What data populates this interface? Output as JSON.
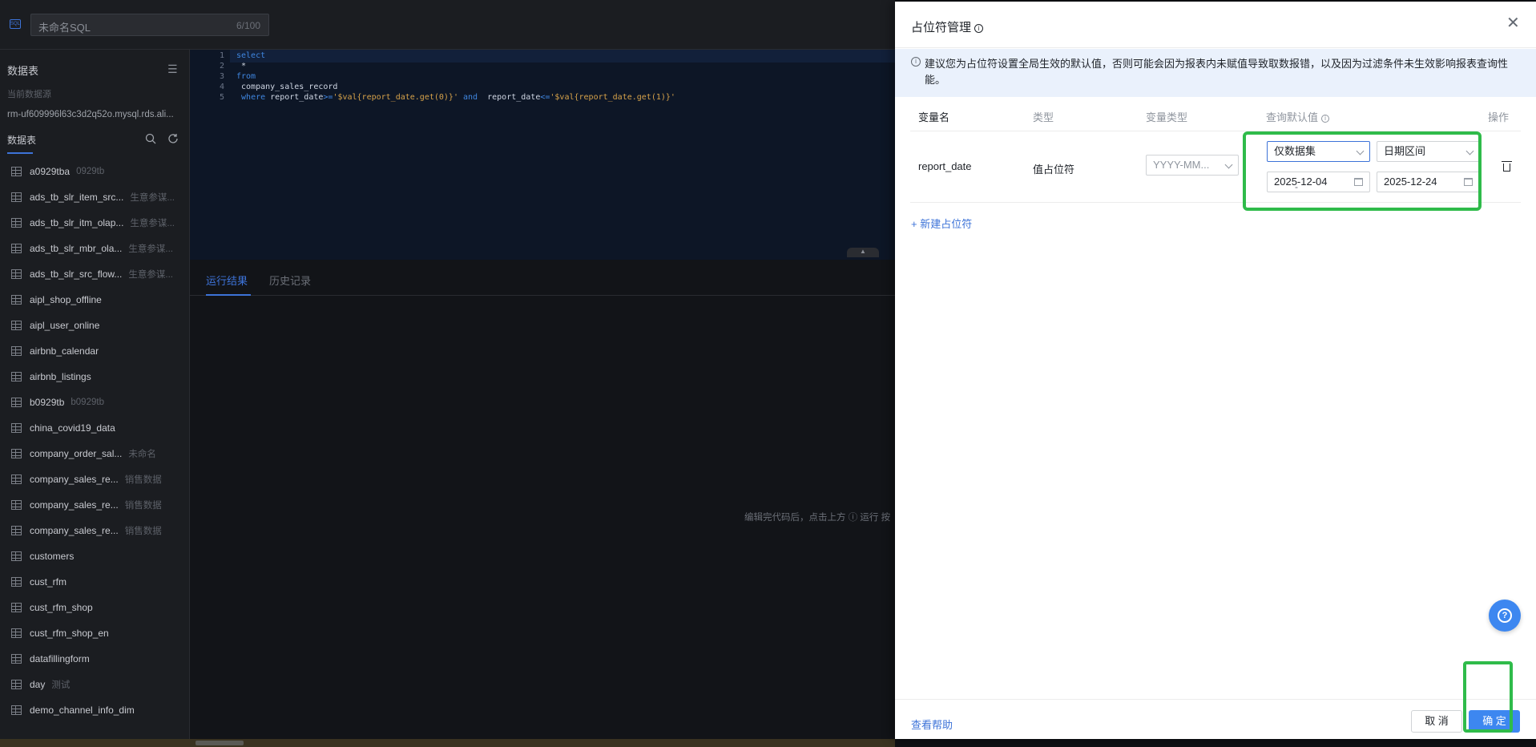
{
  "topbar": {
    "sql_icon": "SQL",
    "query_name": "未命名SQL",
    "name_count": "6/100"
  },
  "sidebar": {
    "title": "数据表",
    "datasource_label": "当前数据源",
    "datasource": "rm-uf609996l63c3d2q52o.mysql.rds.ali...",
    "tab_label": "数据表",
    "tables": [
      {
        "name": "a0929tba",
        "alias": "0929tb"
      },
      {
        "name": "ads_tb_slr_item_src...",
        "alias": "生意参谋..."
      },
      {
        "name": "ads_tb_slr_itm_olap...",
        "alias": "生意参谋..."
      },
      {
        "name": "ads_tb_slr_mbr_ola...",
        "alias": "生意参谋..."
      },
      {
        "name": "ads_tb_slr_src_flow...",
        "alias": "生意参谋..."
      },
      {
        "name": "aipl_shop_offline",
        "alias": ""
      },
      {
        "name": "aipl_user_online",
        "alias": ""
      },
      {
        "name": "airbnb_calendar",
        "alias": ""
      },
      {
        "name": "airbnb_listings",
        "alias": ""
      },
      {
        "name": "b0929tb",
        "alias": "b0929tb"
      },
      {
        "name": "china_covid19_data",
        "alias": ""
      },
      {
        "name": "company_order_sal...",
        "alias": "未命名"
      },
      {
        "name": "company_sales_re...",
        "alias": "销售数据"
      },
      {
        "name": "company_sales_re...",
        "alias": "销售数据"
      },
      {
        "name": "company_sales_re...",
        "alias": "销售数据"
      },
      {
        "name": "customers",
        "alias": ""
      },
      {
        "name": "cust_rfm",
        "alias": ""
      },
      {
        "name": "cust_rfm_shop",
        "alias": ""
      },
      {
        "name": "cust_rfm_shop_en",
        "alias": ""
      },
      {
        "name": "datafillingform",
        "alias": ""
      },
      {
        "name": "day",
        "alias": "测试"
      },
      {
        "name": "demo_channel_info_dim",
        "alias": ""
      }
    ]
  },
  "editor": {
    "line_numbers": [
      "1",
      "2",
      "3",
      "4",
      "5"
    ],
    "l1_kw": "select",
    "l2": " *",
    "l3_kw": "from",
    "l4": " company_sales_record",
    "l5_where": "where",
    "l5_a": " report_date",
    "l5_op1": ">=",
    "l5_str1": "'$val{report_date.get(0)}'",
    "l5_and": " and ",
    "l5_b": " report_date",
    "l5_op2": "<=",
    "l5_str2": "'$val{report_date.get(1)}'"
  },
  "results": {
    "tab_active": "运行结果",
    "tab_history": "历史记录",
    "hint": "编辑完代码后，点击上方 ⓘ 运行 按"
  },
  "drawer": {
    "title": "占位符管理",
    "notice": "建议您为占位符设置全局生效的默认值，否则可能会因为报表内未赋值导致取数报错，以及因为过滤条件未生效影响报表查询性能。",
    "columns": {
      "var_name": "变量名",
      "type": "类型",
      "var_type": "变量类型",
      "default_value": "查询默认值",
      "action": "操作"
    },
    "row": {
      "var_name": "report_date",
      "type": "值占位符",
      "var_type": "YYYY-MM...",
      "scope": "仅数据集",
      "mode": "日期区间",
      "start_date": "2025-12-04",
      "end_date": "2025-12-24",
      "range_sep": "-"
    },
    "add_label": "+ 新建占位符",
    "help_link": "查看帮助",
    "cancel_label": "取 消",
    "ok_label": "确 定"
  },
  "colors": {
    "accent": "#3d73d8",
    "highlight": "#2fbb4a",
    "keyword": "#3f86e0",
    "string": "#d6a24a"
  }
}
